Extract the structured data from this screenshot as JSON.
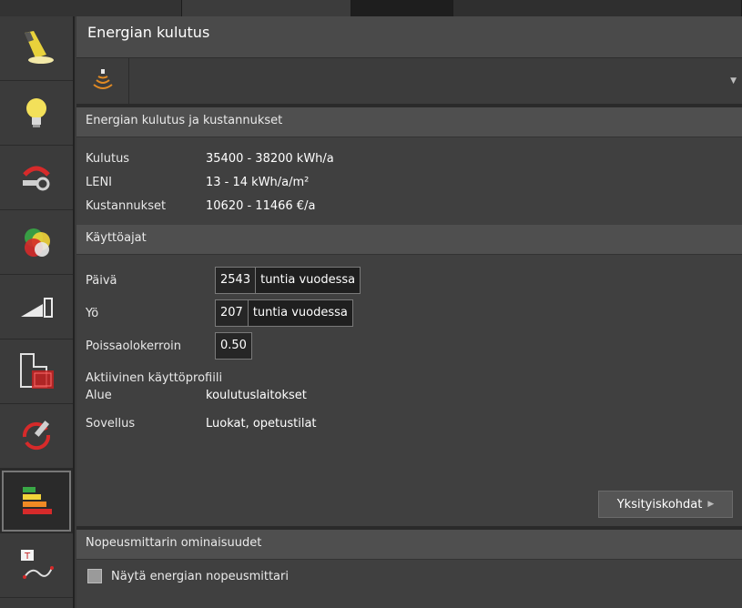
{
  "panel": {
    "title": "Energian kulutus"
  },
  "energy": {
    "header": "Energian kulutus ja kustannukset",
    "rows": [
      {
        "label": "Kulutus",
        "value": "35400 - 38200 kWh/a"
      },
      {
        "label": "LENI",
        "value": "13 - 14 kWh/a/m²"
      },
      {
        "label": "Kustannukset",
        "value": "10620 - 11466 €/a"
      }
    ]
  },
  "usage": {
    "header": "Käyttöajat",
    "day": {
      "label": "Päivä",
      "value": "2543",
      "unit": "tuntia vuodessa"
    },
    "night": {
      "label": "Yö",
      "value": "207",
      "unit": "tuntia vuodessa"
    },
    "absence": {
      "label": "Poissaolokerroin",
      "value": "0.50"
    },
    "profile_title": "Aktiivinen käyttöprofiili",
    "area": {
      "label": "Alue",
      "value": "koulutuslaitokset"
    },
    "application": {
      "label": "Sovellus",
      "value": "Luokat, opetustilat"
    },
    "details_label": "Yksityiskohdat"
  },
  "speedometer": {
    "header": "Nopeusmittarin ominaisuudet",
    "checkbox_label": "Näytä energian nopeusmittari",
    "checked": false
  },
  "toolbar": {
    "icons": [
      "spotlight-icon",
      "bulb-icon",
      "measure-icon",
      "color-circles-icon",
      "signal-bars-icon",
      "floorplan-icon",
      "sync-icon",
      "energy-label-icon",
      "text-curve-icon"
    ],
    "active": "energy-label-icon"
  },
  "colors": {
    "accent_red": "#d62a2a",
    "accent_yellow": "#f2d43a",
    "accent_green": "#39a846"
  }
}
